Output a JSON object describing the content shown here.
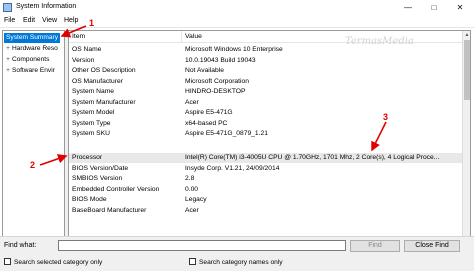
{
  "window": {
    "title": "System Information",
    "minimize": "—",
    "maximize": "□",
    "close": "✕"
  },
  "menu": [
    "File",
    "Edit",
    "View",
    "Help"
  ],
  "tree": {
    "items": [
      {
        "label": "System Summary",
        "expander": ""
      },
      {
        "label": "Hardware Reso",
        "expander": "+"
      },
      {
        "label": "Components",
        "expander": "+"
      },
      {
        "label": "Software Envir",
        "expander": "+"
      }
    ]
  },
  "table": {
    "headers": {
      "item": "Item",
      "value": "Value"
    },
    "rows": [
      {
        "item": "OS Name",
        "value": "Microsoft Windows 10 Enterprise"
      },
      {
        "item": "Version",
        "value": "10.0.19043 Build 19043"
      },
      {
        "item": "Other OS Description",
        "value": "Not Available"
      },
      {
        "item": "OS Manufacturer",
        "value": "Microsoft Corporation"
      },
      {
        "item": "System Name",
        "value": "HINDRO-DESKTOP"
      },
      {
        "item": "System Manufacturer",
        "value": "Acer"
      },
      {
        "item": "System Model",
        "value": "Aspire E5-471G"
      },
      {
        "item": "System Type",
        "value": "x64-based PC"
      },
      {
        "item": "System SKU",
        "value": "Aspire E5-471G_0879_1.21"
      },
      {
        "item": "Processor",
        "value": "Intel(R) Core(TM) i3-4005U CPU @ 1.70GHz, 1701 Mhz, 2 Core(s), 4 Logical Proce..."
      },
      {
        "item": "BIOS Version/Date",
        "value": "Insyde Corp. V1.21, 24/09/2014"
      },
      {
        "item": "SMBIOS Version",
        "value": "2.8"
      },
      {
        "item": "Embedded Controller Version",
        "value": "0.00"
      },
      {
        "item": "BIOS Mode",
        "value": "Legacy"
      },
      {
        "item": "BaseBoard Manufacturer",
        "value": "Acer"
      }
    ]
  },
  "find": {
    "label": "Find what:",
    "value": "",
    "find_button": "Find",
    "close_find_button": "Close Find",
    "check_selected": "Search selected category only",
    "check_names": "Search category names only"
  },
  "annotations": [
    "1",
    "2",
    "3"
  ],
  "watermark": "TermasMedia",
  "colors": {
    "selection": "#0078d7",
    "annotation": "#e00000"
  }
}
